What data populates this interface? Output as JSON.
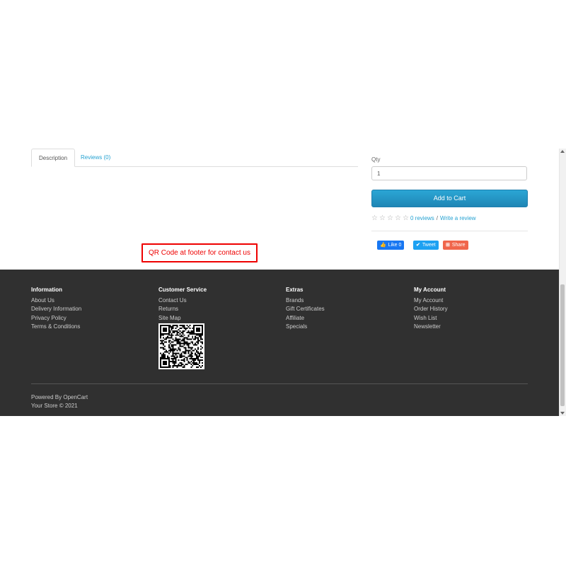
{
  "tabs": [
    {
      "label": "Description",
      "active": true
    },
    {
      "label": "Reviews (0)",
      "active": false
    }
  ],
  "annotation": {
    "text": "QR Code at footer for contact us",
    "color": "#e00000"
  },
  "product": {
    "qty_label": "Qty",
    "qty_value": "1",
    "add_to_cart_label": "Add to Cart",
    "reviews_link": "0 reviews",
    "write_review_link": "Write a review",
    "stars": 5
  },
  "share": {
    "like": "Like 0",
    "tweet": "Tweet",
    "share": "Share"
  },
  "footer": {
    "columns": [
      {
        "title": "Information",
        "items": [
          "About Us",
          "Delivery Information",
          "Privacy Policy",
          "Terms & Conditions"
        ]
      },
      {
        "title": "Customer Service",
        "items": [
          "Contact Us",
          "Returns",
          "Site Map"
        ]
      },
      {
        "title": "Extras",
        "items": [
          "Brands",
          "Gift Certificates",
          "Affiliate",
          "Specials"
        ]
      },
      {
        "title": "My Account",
        "items": [
          "My Account",
          "Order History",
          "Wish List",
          "Newsletter"
        ]
      }
    ],
    "powered_by": "Powered By OpenCart",
    "copyright": "Your Store © 2021"
  },
  "colors": {
    "accent": "#23a1d1",
    "button": "#229ac8",
    "footer_bg": "#303030"
  }
}
